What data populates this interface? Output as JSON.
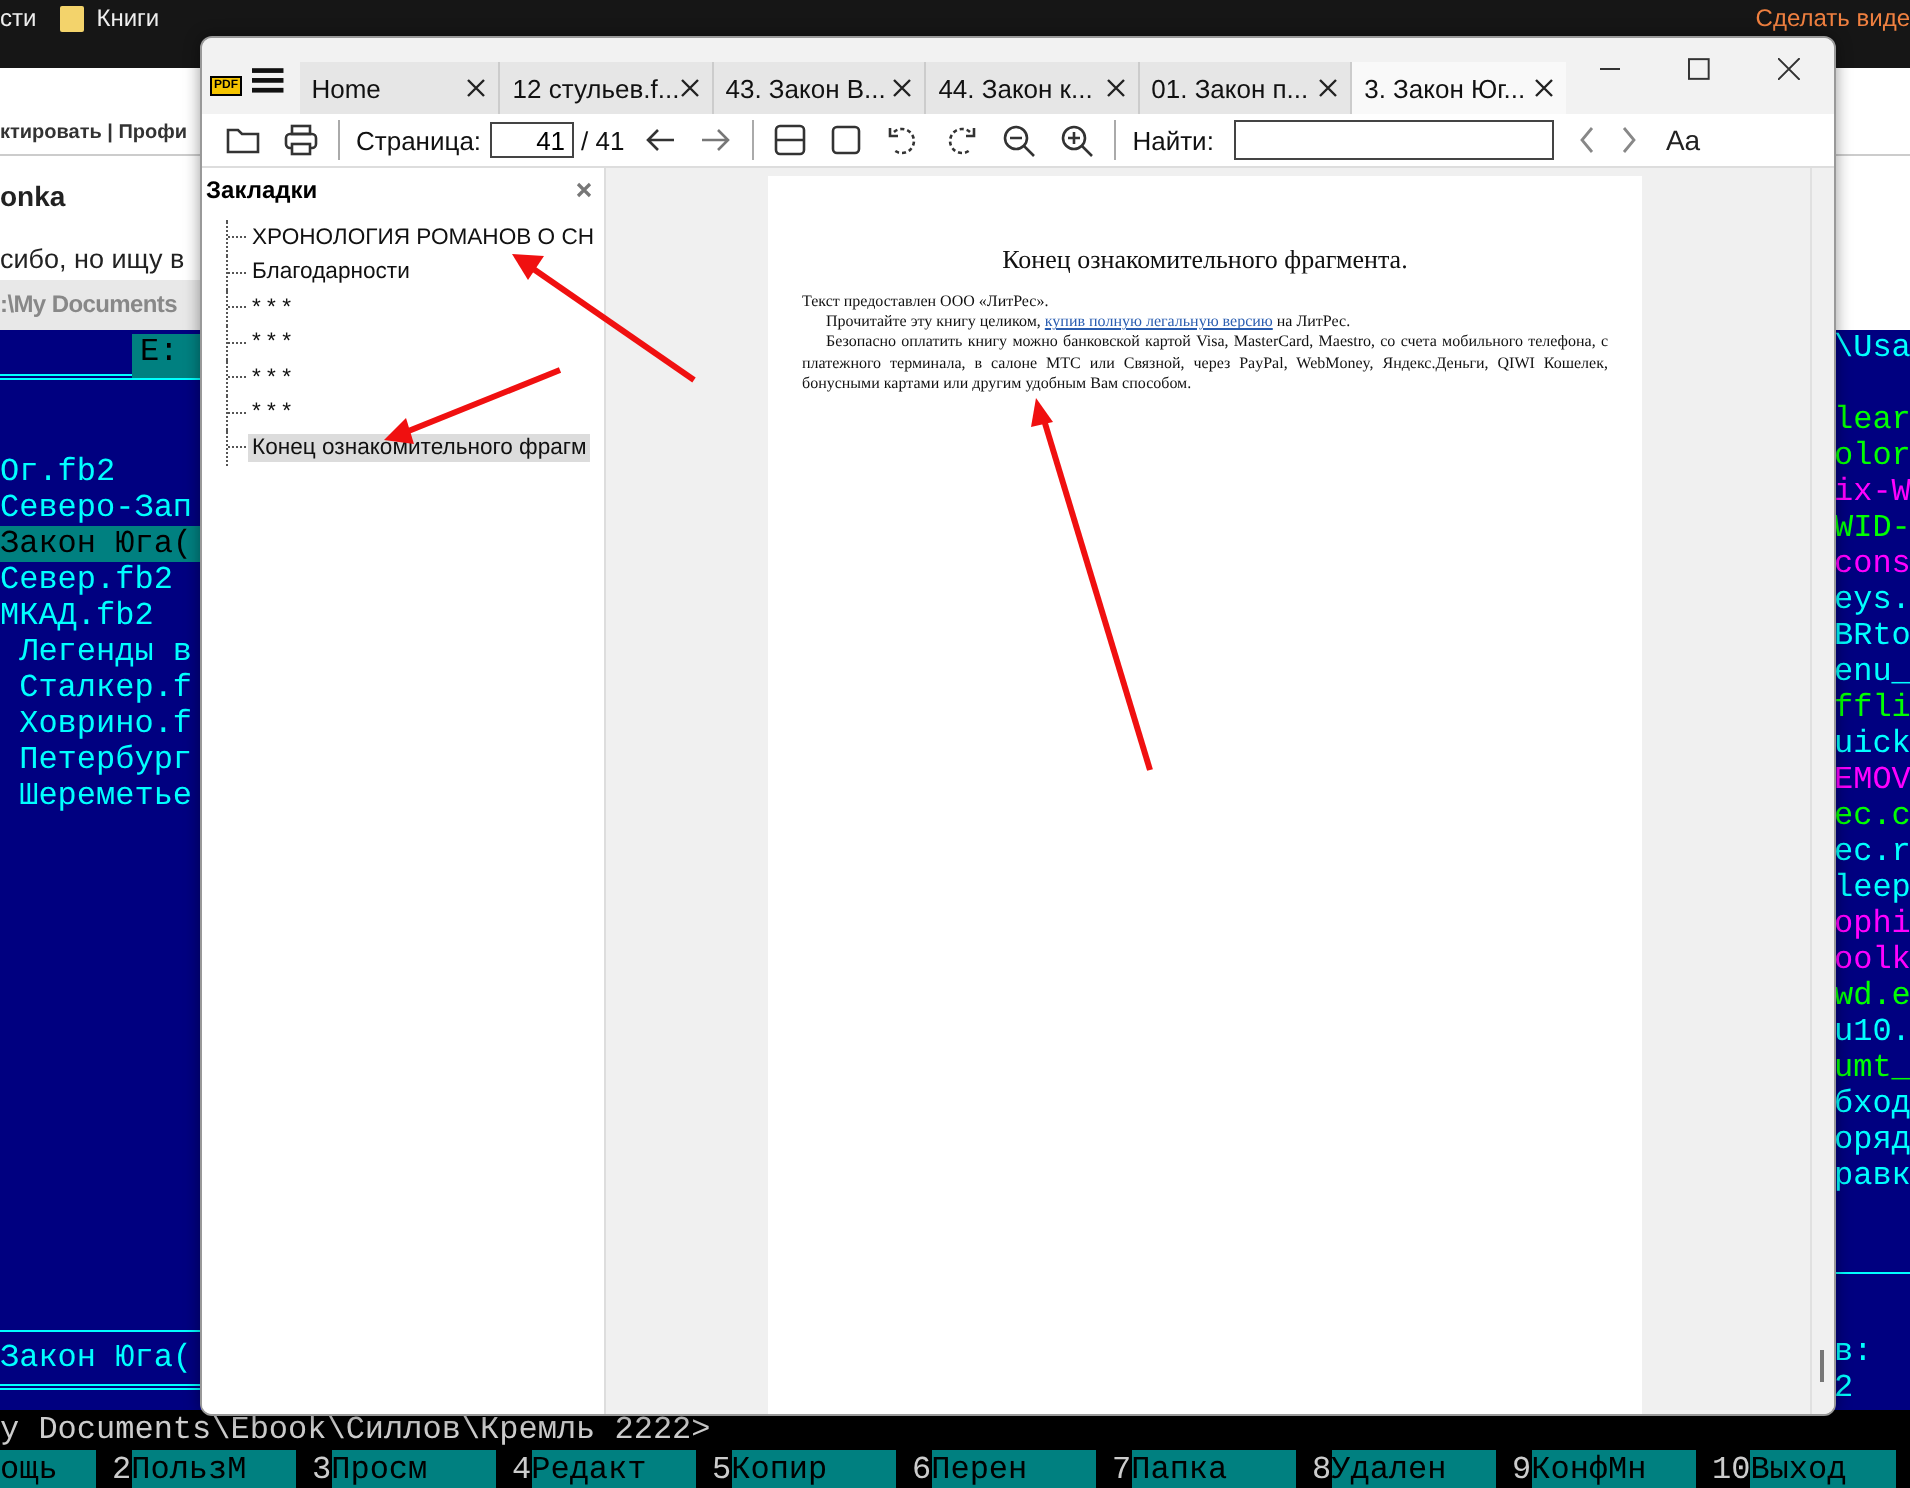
{
  "browser_bookmarks": [
    {
      "label": "сти"
    },
    {
      "label": "Книги"
    },
    {
      "label": "Сделать виде"
    }
  ],
  "web_page": {
    "links_line": "ктировать | Профи",
    "heading": "onka",
    "text": "сибо, но ищу в",
    "path_bar": ":\\My Documents"
  },
  "file_manager": {
    "left_panel": {
      "drive": "E:",
      "files": [
        {
          "name": "Ог.fb2",
          "selected": false
        },
        {
          "name": "Северо-Зап",
          "selected": false
        },
        {
          "name": "Закон Юга(",
          "selected": true
        },
        {
          "name": "Север.fb2",
          "selected": false
        },
        {
          "name": "МКАД.fb2",
          "selected": false
        },
        {
          "name": " Легенды в",
          "selected": false
        },
        {
          "name": " Сталкер.f",
          "selected": false
        },
        {
          "name": " Ховрино.f",
          "selected": false
        },
        {
          "name": " Петербург",
          "selected": false
        },
        {
          "name": " Шереметье",
          "selected": false
        }
      ],
      "footer": "Закон Юга("
    },
    "right_panel": {
      "path": "\\Usa",
      "files": [
        {
          "name": "lear",
          "color": "#00ff00"
        },
        {
          "name": "olor",
          "color": "#00ff00"
        },
        {
          "name": "ix-W",
          "color": "#ff00ff"
        },
        {
          "name": "WID-",
          "color": "#00ff00"
        },
        {
          "name": "cons",
          "color": "#ff00ff"
        },
        {
          "name": "eys.",
          "color": "#00ffff"
        },
        {
          "name": "BRto",
          "color": "#00ffff"
        },
        {
          "name": "enu_",
          "color": "#00ffff"
        },
        {
          "name": "ffli",
          "color": "#00ff00"
        },
        {
          "name": "uick",
          "color": "#00ffff"
        },
        {
          "name": "EMOV",
          "color": "#ff00ff"
        },
        {
          "name": "ec.c",
          "color": "#00ff00"
        },
        {
          "name": "ec.r",
          "color": "#00ffff"
        },
        {
          "name": "leep",
          "color": "#00ffff"
        },
        {
          "name": "ophi",
          "color": "#ff00ff"
        },
        {
          "name": "oolk",
          "color": "#ff00ff"
        },
        {
          "name": "wd.e",
          "color": "#00ff00"
        },
        {
          "name": "u10.",
          "color": "#00ffff"
        },
        {
          "name": "umt_",
          "color": "#00ff00"
        },
        {
          "name": "бход",
          "color": "#00ffff"
        },
        {
          "name": "оряд",
          "color": "#00ffff"
        },
        {
          "name": "равк",
          "color": "#00ffff"
        }
      ],
      "footer": "в: 2"
    },
    "command_line": "y Documents\\Ebook\\Силлов\\Кремль 2222>",
    "function_keys": [
      {
        "label": "ощь"
      },
      {
        "number": "2",
        "label": "ПользМ"
      },
      {
        "number": "3",
        "label": "Просм"
      },
      {
        "number": "4",
        "label": "Редакт"
      },
      {
        "number": "5",
        "label": "Копир"
      },
      {
        "number": "6",
        "label": "Перен"
      },
      {
        "number": "7",
        "label": "Папка"
      },
      {
        "number": "8",
        "label": "Удален"
      },
      {
        "number": "9",
        "label": "КонфМн"
      },
      {
        "number": "10",
        "label": "Выход"
      }
    ]
  },
  "reader_window": {
    "app_icon_label": "PDF",
    "tabs": [
      {
        "label": "Home",
        "selected": false
      },
      {
        "label": "12 стульев.f...",
        "selected": false
      },
      {
        "label": "43. Закон В...",
        "selected": false
      },
      {
        "label": "44. Закон к...",
        "selected": false
      },
      {
        "label": "01. Закон п...",
        "selected": false
      },
      {
        "label": "3. Закон Юг...",
        "selected": true
      }
    ],
    "toolbar": {
      "page_label": "Страница:",
      "page_value": "41",
      "page_total": "/ 41",
      "find_label": "Найти:",
      "font_button": "Aa"
    },
    "bookmarks_panel": {
      "title": "Закладки",
      "items": [
        {
          "label": "ХРОНОЛОГИЯ РОМАНОВ О СН",
          "selected": false
        },
        {
          "label": "Благодарности",
          "selected": false
        },
        {
          "label": "* * *",
          "selected": false
        },
        {
          "label": "* * *",
          "selected": false
        },
        {
          "label": "* * *",
          "selected": false
        },
        {
          "label": "* * *",
          "selected": false
        },
        {
          "label": "Конец ознакомительного фрагм",
          "selected": true
        }
      ]
    },
    "page": {
      "heading": "Конец ознакомительного фрагмента.",
      "paragraph_1": "Текст предоставлен ООО «ЛитРес».",
      "paragraph_2": {
        "before": "Прочитайте эту книгу целиком, ",
        "link": "купив полную легальную версию",
        "after": " на ЛитРес."
      },
      "paragraph_3": "Безопасно оплатить книгу можно банковской картой Visa, MasterCard, Maestro, со счета мобильного телефона, с платежного терминала, в салоне МТС или Связной, через PayPal, WebMoney, Яндекс.Деньги, QIWI Кошелек, бонусными картами или другим удобным Вам способом."
    }
  }
}
